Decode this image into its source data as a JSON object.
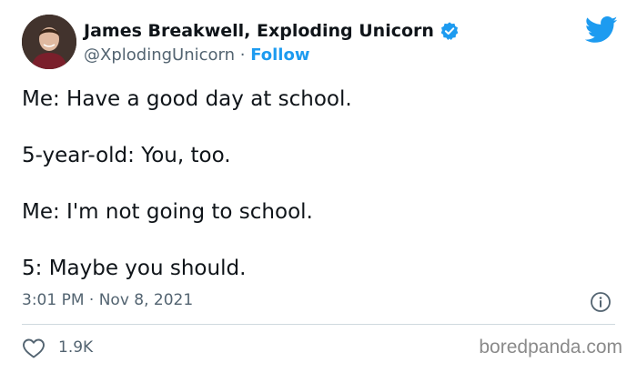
{
  "author": {
    "name": "James Breakwell, Exploding Unicorn",
    "handle": "@XplodingUnicorn",
    "separator": " · ",
    "follow_label": "Follow"
  },
  "tweet": {
    "lines": [
      "Me: Have a good day at school.",
      "5-year-old: You, too.",
      "Me: I'm not going to school.",
      "5: Maybe you should."
    ],
    "timestamp": "3:01 PM · Nov 8, 2021"
  },
  "footer": {
    "like_count": "1.9K",
    "watermark": "boredpanda.com"
  },
  "colors": {
    "accent": "#1d9bf0",
    "text": "#0f1419",
    "secondary": "#536471",
    "divider": "#cfd9de"
  },
  "icons": {
    "verified": "verified-badge-icon",
    "brand": "twitter-bird-icon",
    "info": "info-icon",
    "like": "heart-icon"
  }
}
